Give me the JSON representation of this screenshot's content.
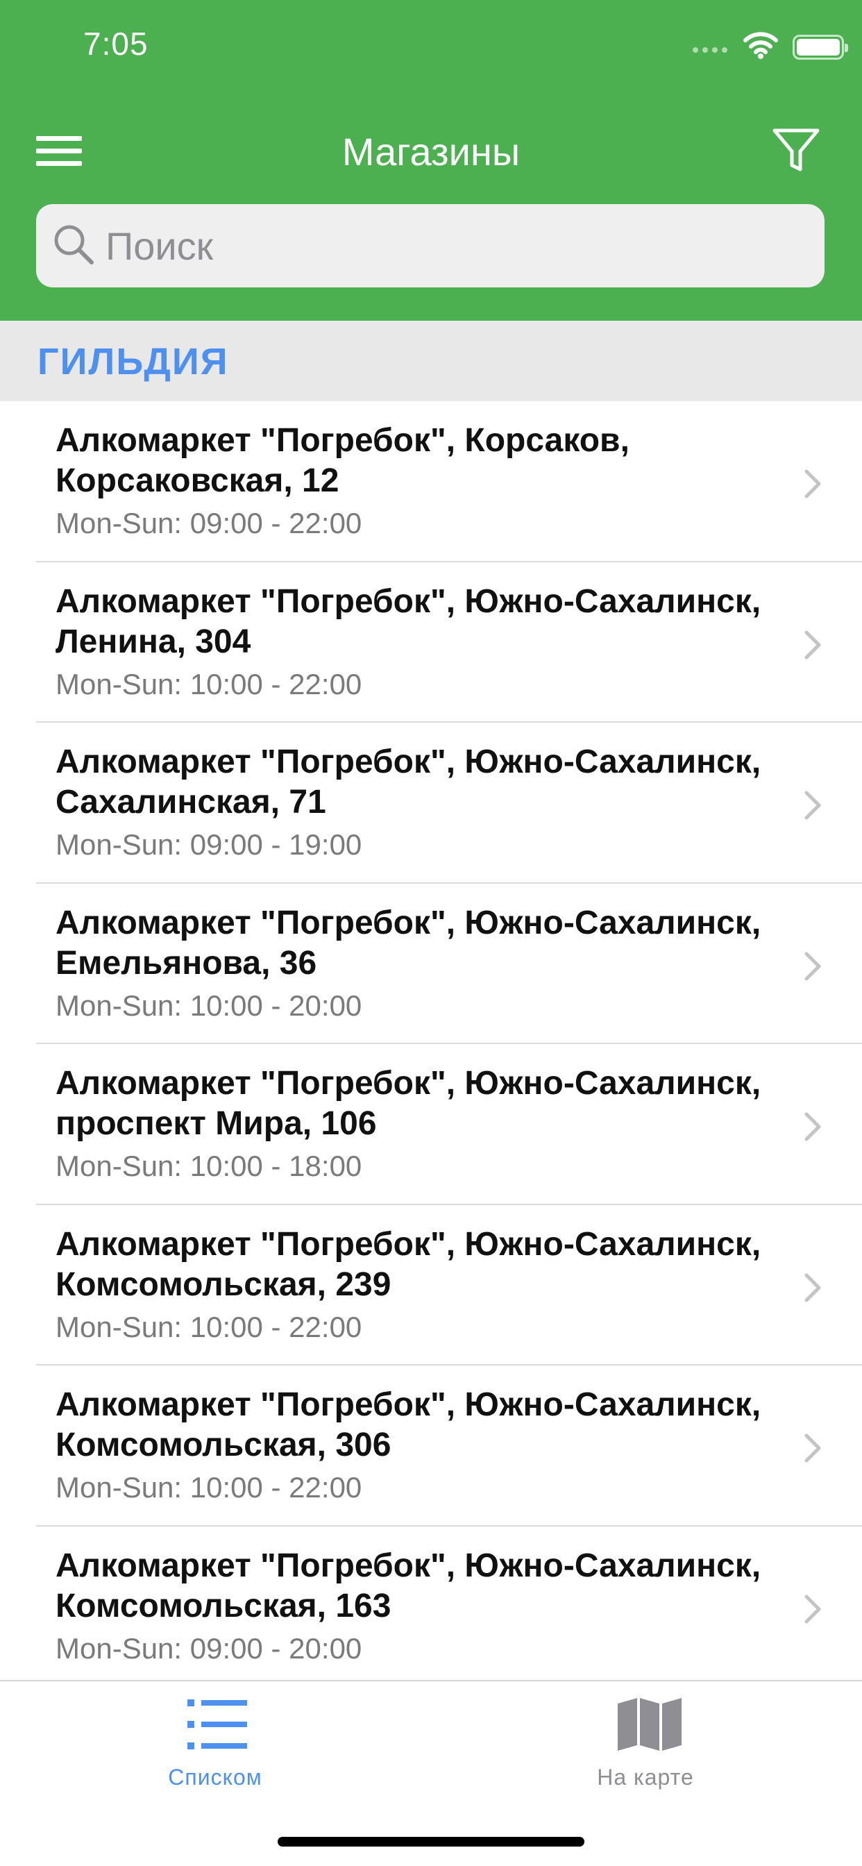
{
  "status_bar": {
    "time": "7:05"
  },
  "nav": {
    "title": "Магазины"
  },
  "search": {
    "placeholder": "Поиск",
    "value": ""
  },
  "section": {
    "title": "ГИЛЬДИЯ"
  },
  "stores": [
    {
      "title": "Алкомаркет \"Погребок\", Корсаков, Корсаковская, 12",
      "hours": "Mon-Sun: 09:00 - 22:00"
    },
    {
      "title": "Алкомаркет \"Погребок\", Южно-Сахалинск, Ленина, 304",
      "hours": "Mon-Sun: 10:00 - 22:00"
    },
    {
      "title": "Алкомаркет \"Погребок\", Южно-Сахалинск, Сахалинская, 71",
      "hours": "Mon-Sun: 09:00 - 19:00"
    },
    {
      "title": "Алкомаркет \"Погребок\", Южно-Сахалинск, Емельянова, 36",
      "hours": "Mon-Sun: 10:00 - 20:00"
    },
    {
      "title": "Алкомаркет \"Погребок\", Южно-Сахалинск, проспект Мира, 106",
      "hours": "Mon-Sun: 10:00 - 18:00"
    },
    {
      "title": "Алкомаркет \"Погребок\", Южно-Сахалинск, Комсомольская, 239",
      "hours": "Mon-Sun: 10:00 - 22:00"
    },
    {
      "title": "Алкомаркет \"Погребок\", Южно-Сахалинск, Комсомольская, 306",
      "hours": "Mon-Sun: 10:00 - 22:00"
    },
    {
      "title": "Алкомаркет \"Погребок\", Южно-Сахалинск, Комсомольская, 163",
      "hours": "Mon-Sun: 09:00 - 20:00"
    }
  ],
  "tabs": [
    {
      "label": "Списком",
      "icon": "list-icon",
      "active": true
    },
    {
      "label": "На карте",
      "icon": "map-icon",
      "active": false
    }
  ],
  "colors": {
    "brand_green": "#4cb050",
    "accent_blue": "#4d90f0",
    "inactive_gray": "#8e8e93"
  }
}
